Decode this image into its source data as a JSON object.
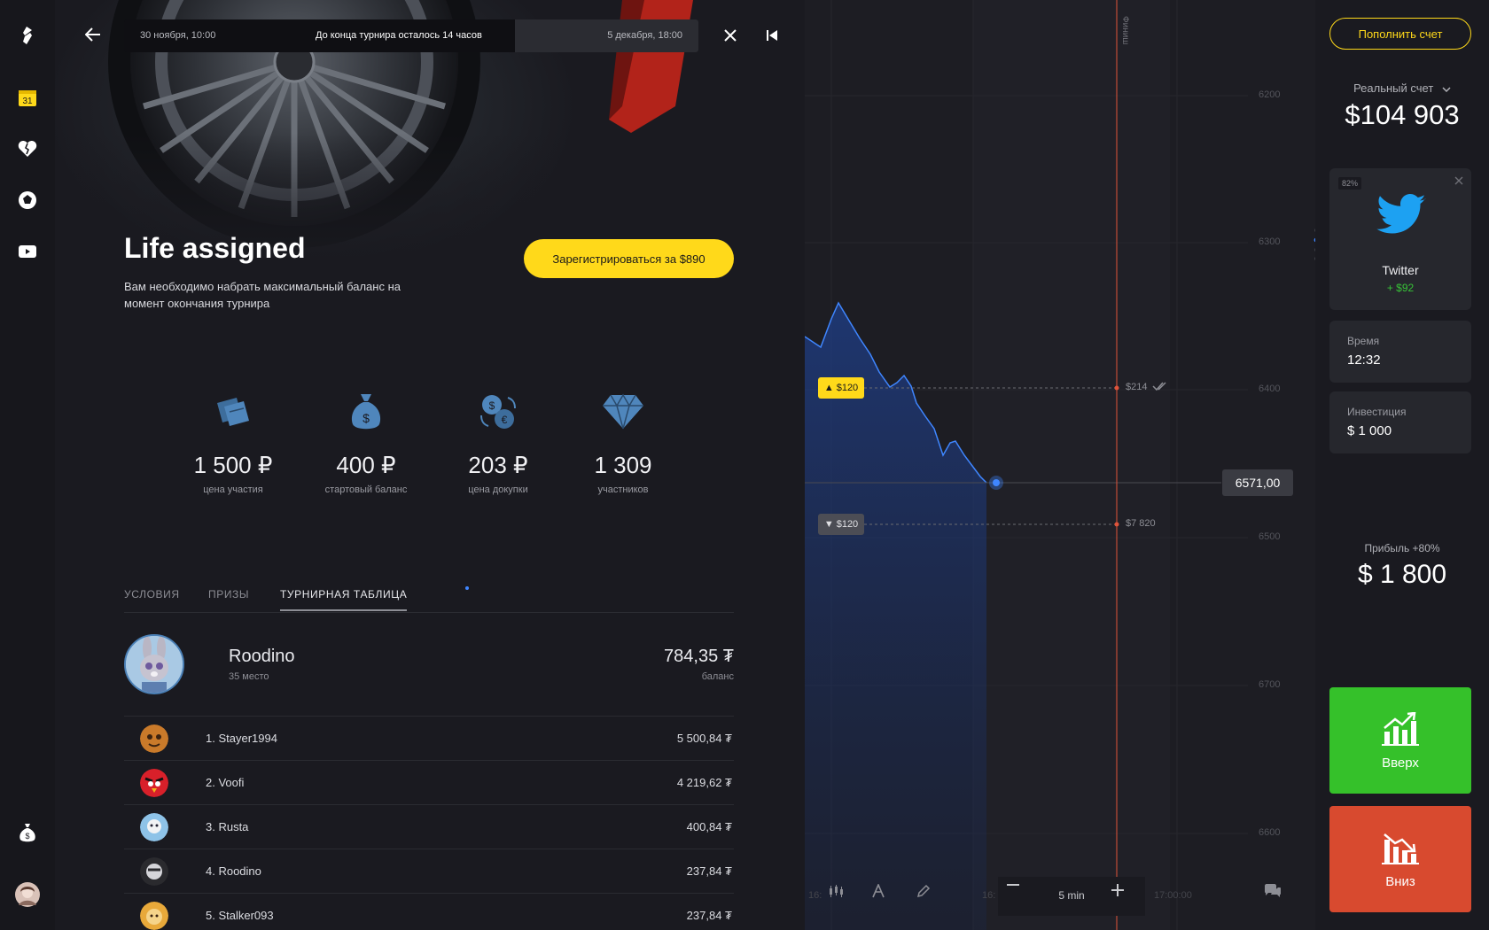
{
  "tournament": {
    "start": "30 ноября, 10:00",
    "remaining": "До конца турнира осталось 14 часов",
    "end": "5 декабря, 18:00",
    "title": "Life assigned",
    "description": "Вам необходимо набрать максимальный баланс на момент окончания турнира",
    "register_label": "Зарегистрироваться  за $890",
    "stats": [
      {
        "value": "1 500 ₽",
        "label": "цена участия",
        "icon": "tickets-icon"
      },
      {
        "value": "400 ₽",
        "label": "стартовый баланс",
        "icon": "money-bag-icon"
      },
      {
        "value": "203 ₽",
        "label": "цена докупки",
        "icon": "exchange-icon"
      },
      {
        "value": "1 309",
        "label": "участников",
        "icon": "diamond-icon"
      }
    ],
    "tabs": [
      "УСЛОВИЯ",
      "ПРИЗЫ",
      "ТУРНИРНАЯ ТАБЛИЦА"
    ],
    "me": {
      "name": "Roodino",
      "place": "35 место",
      "balance": "784,35 ₮",
      "balance_label": "баланс"
    },
    "leaderboard": [
      {
        "name": "1. Stayer1994",
        "score": "5 500,84 ₮"
      },
      {
        "name": "2. Voofi",
        "score": "4 219,62 ₮"
      },
      {
        "name": "3. Rusta",
        "score": "400,84 ₮"
      },
      {
        "name": "4. Roodino",
        "score": "237,84 ₮"
      },
      {
        "name": "5. Stalker093",
        "score": "237,84 ₮"
      }
    ]
  },
  "chart": {
    "current_price": "6571,00",
    "bet_up": "$120",
    "bet_down": "$120",
    "bet_up_value": "$214",
    "bet_down_value": "$7 820",
    "finish_label": "Финиш",
    "y_ticks": [
      "6200",
      "6300",
      "6400",
      "6500",
      "6700",
      "6600"
    ],
    "time_labels": [
      "16:",
      "16:",
      "17:00:00"
    ],
    "timeframe": "5 min",
    "accent": "#3f86ff",
    "finish_line_color": "#e0533a"
  },
  "account": {
    "deposit_label": "Пополнить счет",
    "account_type": "Реальный счет",
    "balance": "$104 903",
    "asset": {
      "percent": "82%",
      "name": "Twitter",
      "profit": "+ $92"
    },
    "time_label": "Время",
    "time_value": "12:32",
    "invest_label": "Инвестиция",
    "invest_value": "$ 1 000",
    "profit_label": "Прибыль +80%",
    "profit_value": "$ 1 800",
    "up_label": "Вверх",
    "down_label": "Вниз",
    "up_color": "#35c12a",
    "down_color": "#d84a2f"
  }
}
